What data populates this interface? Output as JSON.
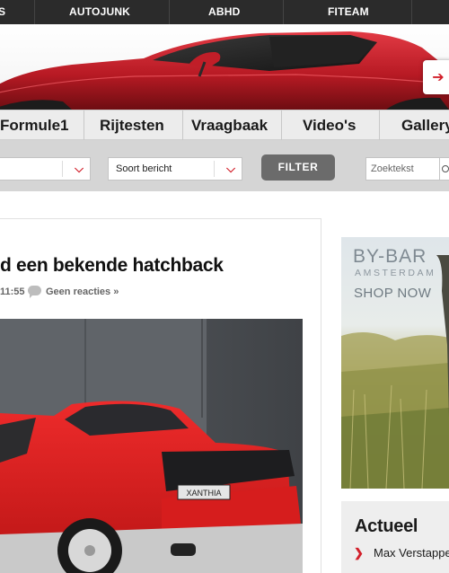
{
  "topnav": {
    "items": [
      {
        "label": "S"
      },
      {
        "label": "AUTOJUNK"
      },
      {
        "label": "ABHD"
      },
      {
        "label": "FITEAM"
      }
    ]
  },
  "mainnav": {
    "items": [
      {
        "label": "Formule1"
      },
      {
        "label": "Rijtesten"
      },
      {
        "label": "Vraagbaak"
      },
      {
        "label": "Video's"
      },
      {
        "label": "Gallery"
      }
    ]
  },
  "filters": {
    "category_value": "",
    "type_value": "Soort bericht",
    "filter_label": "FILTER",
    "search_placeholder": "Zoektekst"
  },
  "article": {
    "title": "d een bekende hatchback",
    "time": "11:55",
    "comments": "Geen reacties »",
    "badge_text": "XANTHIA"
  },
  "ad": {
    "brand_line1": "BY-BAR",
    "brand_line2": "AMSTERDAM",
    "cta": "SHOP NOW"
  },
  "sidebar": {
    "title": "Actueel",
    "items": [
      {
        "label": "Max Verstappen"
      }
    ]
  },
  "colors": {
    "accent": "#d21f2a",
    "topbar": "#2b2b2b",
    "filter_bg": "#d5d5d5"
  }
}
